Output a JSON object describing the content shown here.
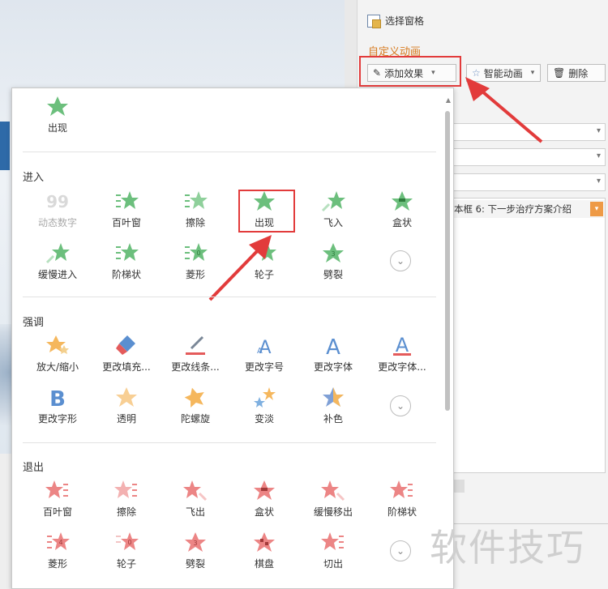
{
  "pane": {
    "select_pane": "选择窗格",
    "section_title": "自定义动画",
    "add_effect": "添加效果",
    "smart_animation": "智能动画",
    "delete": "删除",
    "list_item": "本框 6: 下一步治疗方案介绍"
  },
  "popup": {
    "top_item": "出现",
    "groups": {
      "enter": "进入",
      "emphasis": "强调",
      "exit": "退出"
    },
    "enter": [
      "动态数字",
      "百叶窗",
      "擦除",
      "出现",
      "飞入",
      "盒状",
      "缓慢进入",
      "阶梯状",
      "菱形",
      "轮子",
      "劈裂"
    ],
    "emphasis": [
      "放大/缩小",
      "更改填充...",
      "更改线条...",
      "更改字号",
      "更改字体",
      "更改字体...",
      "更改字形",
      "透明",
      "陀螺旋",
      "变淡",
      "补色"
    ],
    "exit": [
      "百叶窗",
      "擦除",
      "飞出",
      "盒状",
      "缓慢移出",
      "阶梯状",
      "菱形",
      "轮子",
      "劈裂",
      "棋盘",
      "切出"
    ]
  },
  "watermark": "软件技巧",
  "colors": {
    "enter": "#6cbf7d",
    "emphasis": "#f5b75d",
    "exit": "#ec8585",
    "highlight": "#e23b3b",
    "accent": "#d77a1e"
  }
}
